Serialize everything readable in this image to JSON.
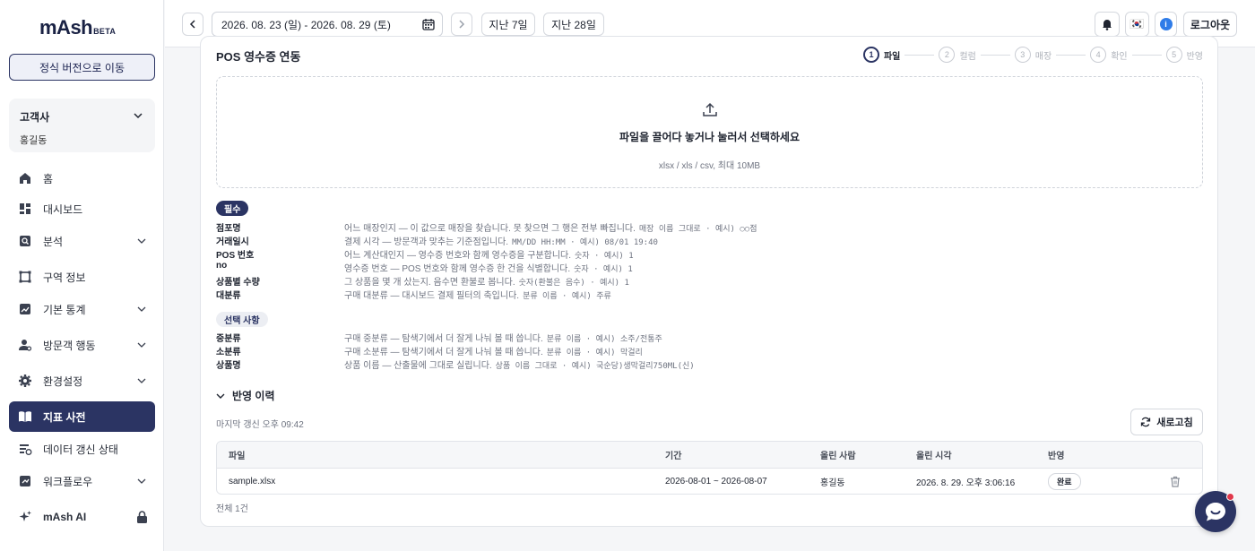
{
  "app": {
    "logo": "mAsh",
    "logo_badge": "BETA",
    "official_button": "정식 버전으로 이동"
  },
  "customer": {
    "label": "고객사",
    "value": "홍길동"
  },
  "nav": [
    {
      "label": "홈",
      "icon": "home-icon"
    },
    {
      "label": "대시보드",
      "icon": "dashboard-icon"
    },
    {
      "label": "분석",
      "icon": "analysis-icon"
    },
    {
      "label": "구역 정보",
      "icon": "zone-icon"
    },
    {
      "label": "기본 통계",
      "icon": "stats-icon"
    },
    {
      "label": "방문객 행동",
      "icon": "visitor-icon"
    },
    {
      "label": "환경설정",
      "icon": "settings-icon"
    },
    {
      "label": "지표 사전",
      "icon": "book-icon"
    },
    {
      "label": "데이터 갱신 상태",
      "icon": "data-status-icon"
    },
    {
      "label": "워크플로우",
      "icon": "workflow-icon"
    },
    {
      "label": "mAsh AI",
      "icon": "sparkle-icon"
    }
  ],
  "topbar": {
    "date_range": "2026. 08. 23 (일) - 2026. 08. 29 (토)",
    "last7": "지난 7일",
    "last28": "지난 28일",
    "flag": "🇰🇷",
    "info": "i",
    "logout": "로그아웃"
  },
  "card": {
    "title": "POS 영수증 연동",
    "steps": [
      {
        "num": "1",
        "label": "파일"
      },
      {
        "num": "2",
        "label": "컬럼"
      },
      {
        "num": "3",
        "label": "매장"
      },
      {
        "num": "4",
        "label": "확인"
      },
      {
        "num": "5",
        "label": "반영"
      }
    ],
    "dropzone": {
      "main": "파일을 끌어다 놓거나 눌러서 선택하세요",
      "sub": "xlsx / xls / csv, 최대 10MB"
    },
    "required_label": "필수",
    "optional_label": "선택 사항",
    "required_fields": [
      {
        "name": "점포명",
        "desc": "어느 매장인지 — 이 값으로 매장을 찾습니다. 못 찾으면 그 행은 전부 빠집니다.",
        "hint": "매장 이름 그대로 · 예시) ○○점"
      },
      {
        "name": "거래일시",
        "desc": "결제 시각 — 방문객과 맞추는 기준점입니다.",
        "hint": "MM/DD HH:MM · 예시) 08/01 19:40"
      },
      {
        "name": "POS 번호",
        "desc": "어느 계산대인지 — 영수증 번호와 함께 영수증을 구분합니다.",
        "hint": "숫자 · 예시) 1"
      },
      {
        "name": "no",
        "desc": "영수증 번호 — POS 번호와 함께 영수증 한 건을 식별합니다.",
        "hint": "숫자 · 예시) 1"
      },
      {
        "name": "상품별 수량",
        "desc": "그 상품을 몇 개 샀는지. 음수면 환불로 봅니다.",
        "hint": "숫자(환불은 음수) · 예시) 1"
      },
      {
        "name": "대분류",
        "desc": "구매 대분류 — 대시보드 결제 필터의 축입니다.",
        "hint": "분류 이름 · 예시) 주류"
      }
    ],
    "optional_fields": [
      {
        "name": "중분류",
        "desc": "구매 중분류 — 탐색기에서 더 잘게 나눠 볼 때 씁니다.",
        "hint": "분류 이름 · 예시) 소주/전통주"
      },
      {
        "name": "소분류",
        "desc": "구매 소분류 — 탐색기에서 더 잘게 나눠 볼 때 씁니다.",
        "hint": "분류 이름 · 예시) 막걸리"
      },
      {
        "name": "상품명",
        "desc": "상품 이름 — 산출물에 그대로 실립니다.",
        "hint": "상품 이름 그대로 · 예시) 국순당)생막걸리750ML(신)"
      }
    ],
    "history": {
      "title": "반영 이력",
      "last_sync": "마지막 갱신 오후 09:42",
      "refresh": "새로고침",
      "columns": [
        "파일",
        "기간",
        "올린 사람",
        "올린 시각",
        "반영"
      ],
      "rows": [
        {
          "file": "sample.xlsx",
          "period": "2026-08-01 ~ 2026-08-07",
          "uploader": "홍길동",
          "uploaded_at": "2026. 8. 29. 오후 3:06:16",
          "status": "완료"
        }
      ],
      "total": "전체 1건"
    }
  },
  "colors": {
    "primary": "#2b3463",
    "accent_red": "#e0384b"
  }
}
